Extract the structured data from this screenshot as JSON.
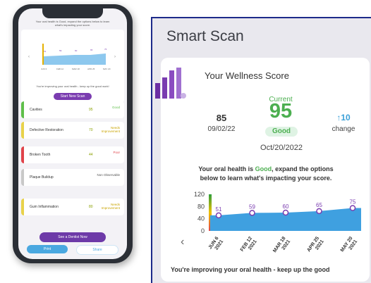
{
  "phone": {
    "intro_a": "Your oral health is Good, expand the options below to learn",
    "intro_b": "what's impacting your score.",
    "chart": {
      "ylabels": [
        "120",
        "80",
        "40",
        "0"
      ],
      "points": [
        "51",
        "59",
        "60",
        "65",
        "75"
      ],
      "dates": [
        "JUN 6 2021",
        "FEB 12 2021",
        "MAR 18 2021",
        "APR 25 2021",
        "MAY 20 2021"
      ]
    },
    "improving": "You're improving your oral health - keep up the good work!",
    "start_scan": "Start New Scan",
    "items": [
      {
        "label": "Cavities",
        "value": "95",
        "status": "Good",
        "color": "#5fbf4a"
      },
      {
        "label": "Defective Restoration",
        "value": "70",
        "status": "Needs Improvement",
        "color": "#e8d24a"
      },
      {
        "label": "Broken Tooth",
        "value": "44",
        "status": "Poor",
        "color": "#e0434a"
      },
      {
        "label": "Plaque Buildup",
        "value": "",
        "status": "Non Observable",
        "color": "#c8c8c8"
      },
      {
        "label": "Gum Inflammation",
        "value": "80",
        "status": "Needs Improvement",
        "color": "#e8d24a"
      }
    ],
    "dentist": "See a Dentist Now",
    "print": "Print",
    "share": "Share"
  },
  "panel": {
    "title": "Smart Scan",
    "card_title": "Your Wellness Score",
    "previous_score": "85",
    "previous_date": "09/02/22",
    "current_label": "Current",
    "current_score": "95",
    "current_status": "Good",
    "current_date": "Oct/20/2022",
    "change_value": "↑10",
    "change_label": "change",
    "message_a": "Your oral health is ",
    "message_good": "Good",
    "message_b": ", expand the options",
    "message_c": "below to learn what's impacting your score.",
    "footer": "You're improving your oral health - keep up the good"
  },
  "chart_data": {
    "type": "area",
    "categories": [
      "JUN 6 2021",
      "FEB 12 2021",
      "MAR 18 2021",
      "APR 25 2021",
      "MAY 20 2021"
    ],
    "values": [
      51,
      59,
      60,
      65,
      75
    ],
    "ylim": [
      0,
      120
    ],
    "yticks": [
      "120",
      "80",
      "40",
      "0"
    ],
    "xlabels": [
      [
        "JUN 6",
        "2021"
      ],
      [
        "FEB 12",
        "2021"
      ],
      [
        "MAR 18",
        "2021"
      ],
      [
        "APR 25",
        "2021"
      ],
      [
        "MAY 20",
        "2021"
      ]
    ],
    "colors": {
      "fill": "#3fa0e0",
      "marker": "#7a3cb0",
      "label": "#7a3cb0"
    }
  },
  "colors": {
    "accent": "#7a3cb0",
    "good": "#4caf50",
    "up": "#3ba0d8"
  }
}
